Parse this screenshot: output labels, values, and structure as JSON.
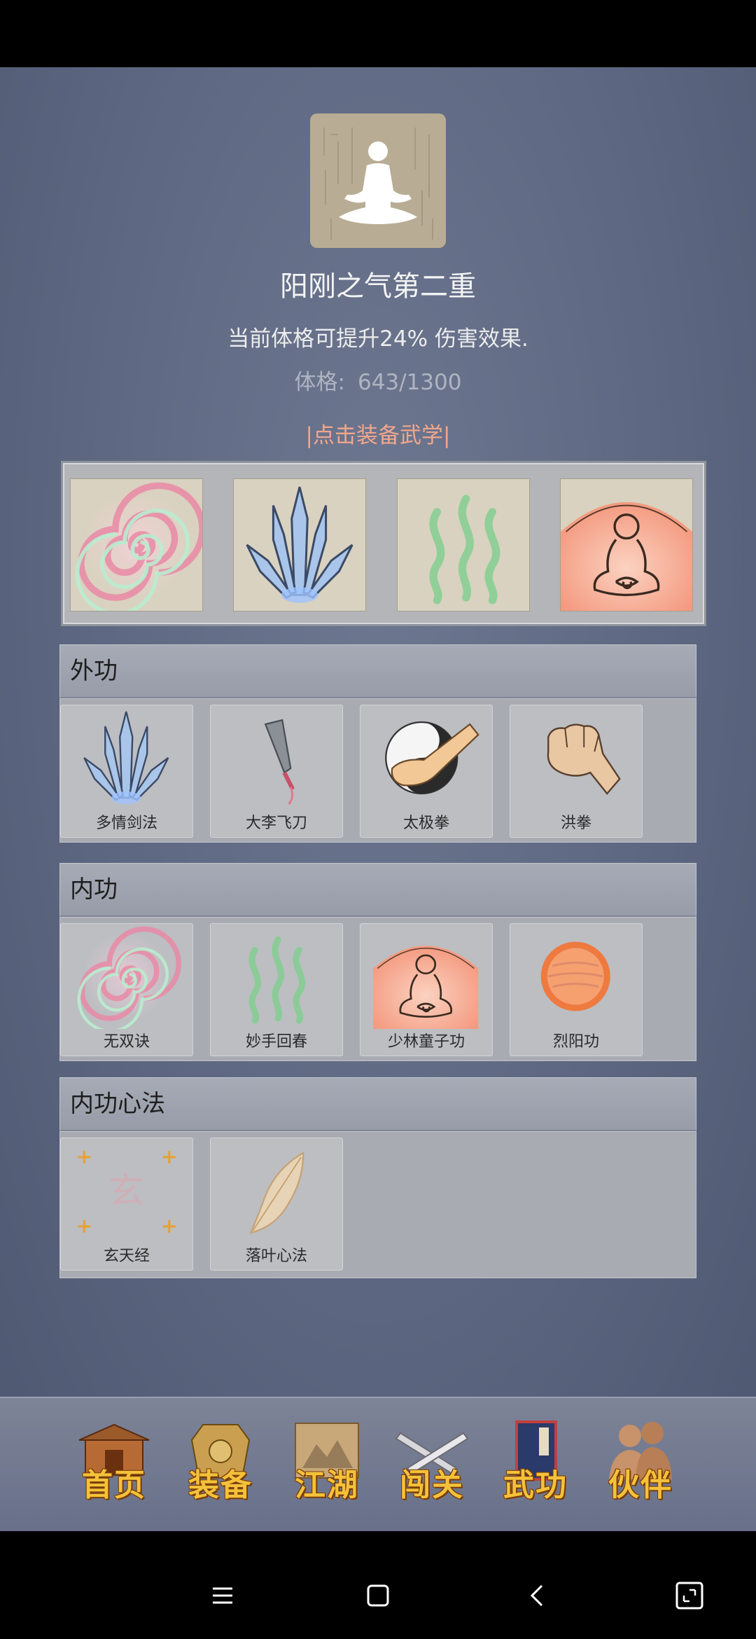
{
  "header": {
    "avatar_icon": "meditation-icon",
    "title": "阳刚之气第二重",
    "description": "当前体格可提升24% 伤害效果.",
    "stat_label": "体格:",
    "stat_value": "643/1300",
    "equip_link": "|点击装备武学|"
  },
  "equipped": [
    {
      "icon": "spiral-icon"
    },
    {
      "icon": "sword-fan-icon"
    },
    {
      "icon": "green-wave-icon"
    },
    {
      "icon": "buddha-icon"
    }
  ],
  "sections": [
    {
      "title": "外功",
      "items": [
        {
          "label": "多情剑法",
          "icon": "sword-fan-icon"
        },
        {
          "label": "大李飞刀",
          "icon": "flying-knife-icon"
        },
        {
          "label": "太极拳",
          "icon": "taiji-fist-icon"
        },
        {
          "label": "洪拳",
          "icon": "fist-icon"
        }
      ]
    },
    {
      "title": "内功",
      "items": [
        {
          "label": "无双诀",
          "icon": "spiral-icon"
        },
        {
          "label": "妙手回春",
          "icon": "green-wave-icon"
        },
        {
          "label": "少林童子功",
          "icon": "buddha-icon"
        },
        {
          "label": "烈阳功",
          "icon": "sun-orb-icon"
        }
      ]
    },
    {
      "title": "内功心法",
      "items": [
        {
          "label": "玄天经",
          "icon": "xuan-scroll-icon"
        },
        {
          "label": "落叶心法",
          "icon": "leaf-icon"
        }
      ]
    }
  ],
  "nav": [
    {
      "label": "首页",
      "icon": "temple-icon"
    },
    {
      "label": "装备",
      "icon": "armor-icon"
    },
    {
      "label": "江湖",
      "icon": "map-scroll-icon"
    },
    {
      "label": "闯关",
      "icon": "crossed-swords-icon"
    },
    {
      "label": "武功",
      "icon": "book-icon"
    },
    {
      "label": "伙伴",
      "icon": "partners-icon"
    }
  ],
  "xuan_glyph": "玄",
  "system_nav": [
    "menu-icon",
    "home-icon",
    "back-icon",
    "screenshot-icon"
  ],
  "colors": {
    "accent_link": "#f1a78c",
    "nav_text": "#f4c23a"
  }
}
